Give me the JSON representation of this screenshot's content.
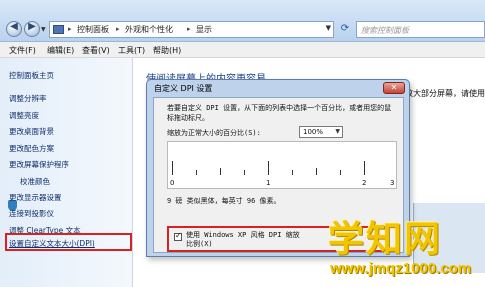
{
  "address_bar": {
    "crumbs": [
      "控制面板",
      "外观和个性化",
      "显示"
    ],
    "search_placeholder": "搜索控制面板"
  },
  "menu": [
    "文件(F)",
    "编辑(E)",
    "查看(V)",
    "工具(T)",
    "帮助(H)"
  ],
  "sidebar": {
    "home": "控制面板主页",
    "items": [
      "调整分辨率",
      "调整亮度",
      "更改桌面背景",
      "更改配色方案",
      "更改屏幕保护程序",
      "校准颜色",
      "更改显示器设置",
      "连接到投影仪",
      "调整 ClearType 文本",
      "设置自定义文本大小(DPI)"
    ]
  },
  "main": {
    "heading": "使阅读屏幕上的内容更容易",
    "partial_text": "放大部分屏幕，请使用"
  },
  "dialog": {
    "title": "自定义 DPI 设置",
    "instruction": "若要自定义 DPI 设置，从下面的列表中选择一个百分比，或者用您的鼠标拖动标尺。",
    "scale_label": "缩放为正常大小的百分比(S):",
    "scale_value": "100%",
    "ruler_numbers": [
      "0",
      "1",
      "2",
      "3"
    ],
    "pixel_note": "9 磅 类似黑体，每英寸 96 像素。",
    "checkbox_label": "使用 Windows XP 风格 DPI 缩放比例(X)",
    "checkbox_checked": true
  },
  "watermark": {
    "text": "学知网",
    "url": "www.jmqz1000.com"
  }
}
